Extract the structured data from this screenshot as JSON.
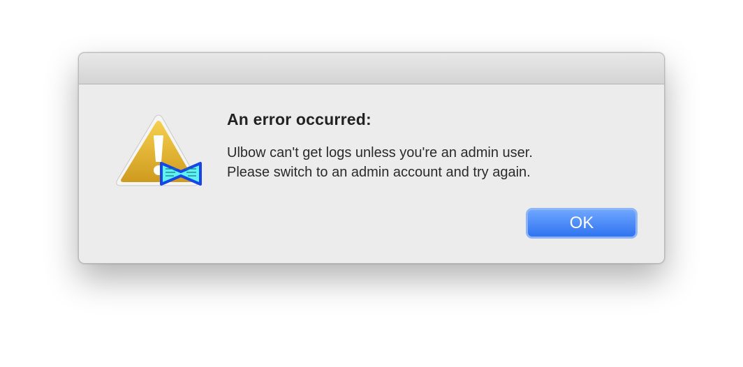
{
  "alert": {
    "heading": "An error occurred:",
    "message_lines": [
      "Ulbow can't get logs unless you're an admin user.",
      "Please switch to an admin account and try again."
    ],
    "ok_label": "OK",
    "icon": "caution-triangle-icon",
    "badge_icon": "ulbow-app-icon"
  },
  "colors": {
    "dialog_background": "#ececec",
    "button_blue": "#3f82f5",
    "warning_yellow": "#e7b93c",
    "badge_cyan": "#5ff2f2",
    "badge_blue": "#1646e6"
  }
}
